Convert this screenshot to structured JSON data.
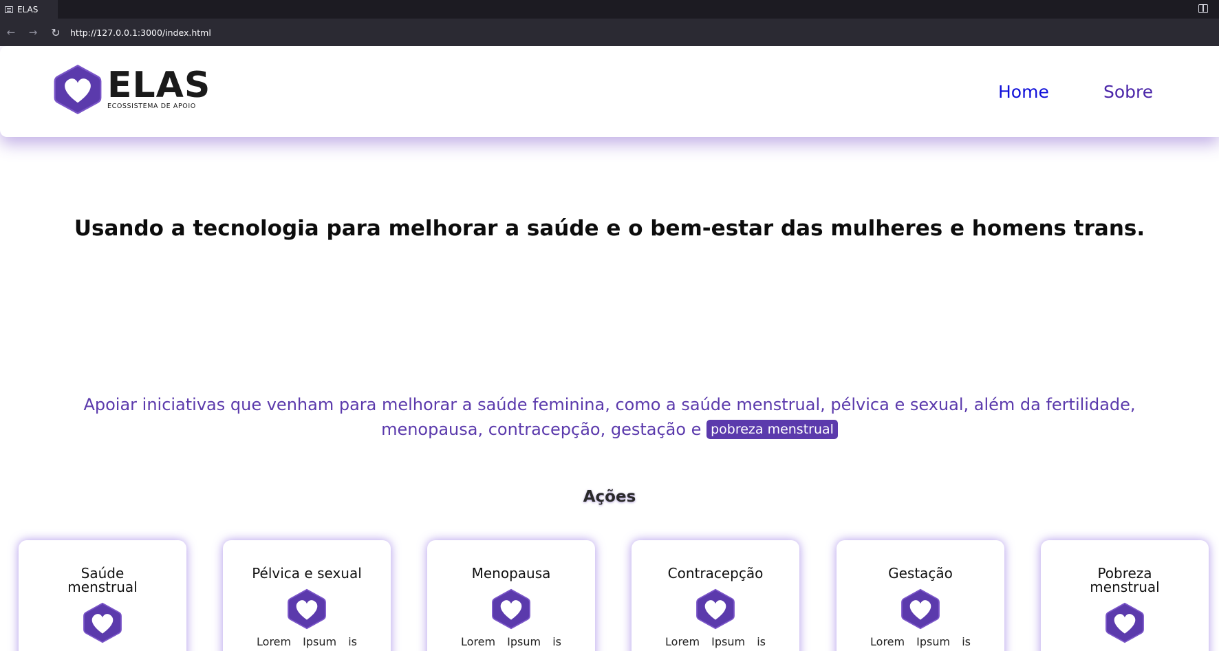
{
  "browser": {
    "tab_title": "ELAS",
    "url": "http://127.0.0.1:3000/index.html",
    "icons": {
      "back": "arrow-left-icon",
      "forward": "arrow-right-icon",
      "reload": "reload-icon",
      "sidebar": "sidebar-icon"
    }
  },
  "header": {
    "logo_word": "ELAS",
    "logo_subtitle": "ECOSSISTEMA DE APOIO",
    "nav": {
      "home": "Home",
      "sobre": "Sobre"
    }
  },
  "hero": {
    "tagline": "Usando a tecnologia para melhorar a saúde e o bem-estar das mulheres e homens trans."
  },
  "mission": {
    "text": "Apoiar iniciativas que venham para melhorar a saúde feminina, como a saúde menstrual, pélvica e sexual, além da fertilidade, menopausa, contracepção, gestação e",
    "highlight": "pobreza menstrual"
  },
  "actions": {
    "title": "Ações",
    "cards": [
      {
        "title": "Saúde menstrual",
        "text": ""
      },
      {
        "title": "Pélvica e sexual",
        "text": "Lorem Ipsum is"
      },
      {
        "title": "Menopausa",
        "text": "Lorem Ipsum is"
      },
      {
        "title": "Contracepção",
        "text": "Lorem Ipsum is"
      },
      {
        "title": "Gestação",
        "text": "Lorem Ipsum is"
      },
      {
        "title": "Pobreza menstrual",
        "text": ""
      }
    ]
  },
  "colors": {
    "brand_purple": "#5b3aac",
    "home_link": "#0f0fd9"
  }
}
